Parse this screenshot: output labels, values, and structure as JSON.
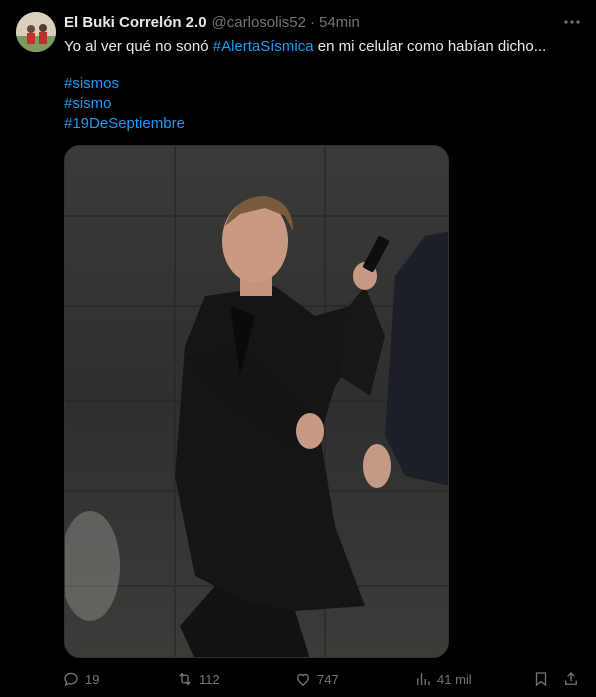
{
  "tweet": {
    "display_name": "El Buki Correlón 2.0",
    "handle": "@carlosolis52",
    "separator": "·",
    "time": "54min",
    "text_before": "Yo al ver qué no sonó ",
    "text_hashtag": "#AlertaSísmica",
    "text_after": " en mi celular como habían dicho...",
    "hashtags": [
      "#sismos",
      "#sismo",
      "#19DeSeptiembre"
    ]
  },
  "actions": {
    "replies": "19",
    "retweets": "112",
    "likes": "747",
    "views": "41 mil"
  },
  "colors": {
    "background": "#000000",
    "text": "#e7e9ea",
    "muted": "#71767b",
    "link": "#1d9bf0"
  },
  "icons": [
    "more-icon",
    "reply-icon",
    "retweet-icon",
    "like-icon",
    "views-icon",
    "bookmark-icon",
    "share-icon"
  ]
}
